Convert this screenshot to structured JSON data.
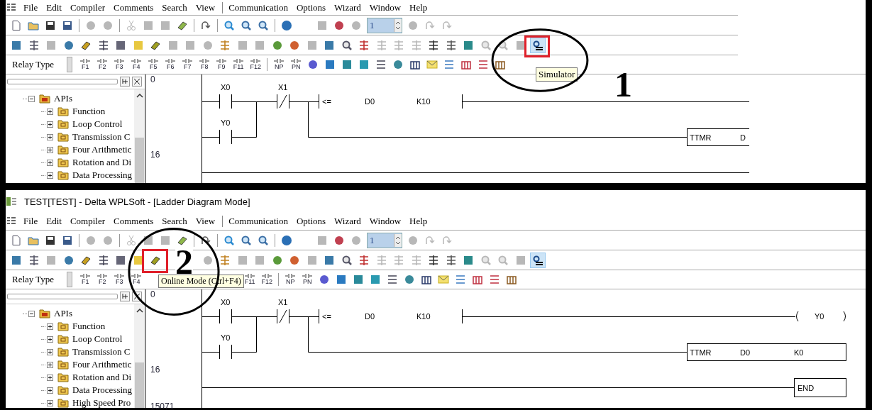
{
  "panels": [
    {
      "cropped_right": true,
      "menu": [
        "File",
        "Edit",
        "Compiler",
        "Comments",
        "Search",
        "View",
        "Communication",
        "Options",
        "Wizard",
        "Window",
        "Help"
      ],
      "spinner_value": "1",
      "relay_type": "Relay Type",
      "function_keys": [
        "F1",
        "F2",
        "F3",
        "F4",
        "F5",
        "F6",
        "F7",
        "F8",
        "F9",
        "F11",
        "F12",
        "NP",
        "PN"
      ],
      "simulator_marked": true,
      "online_mode_marked": false,
      "simulator_active": true,
      "tooltip": "Simulator",
      "annotation_number": "1",
      "tree": {
        "label": "APIs",
        "expanded": true,
        "children": [
          {
            "label": "Function",
            "expanded": false
          },
          {
            "label": "Loop Control",
            "expanded": false
          },
          {
            "label": "Transmission C",
            "expanded": false
          },
          {
            "label": "Four Arithmetic",
            "expanded": false
          },
          {
            "label": "Rotation and Di",
            "expanded": false
          },
          {
            "label": "Data Processing",
            "expanded": false
          }
        ]
      },
      "line_numbers": [
        "0",
        "16"
      ],
      "ladder": {
        "contacts": [
          {
            "label": "X0",
            "kind": "no"
          },
          {
            "label": "Y0",
            "kind": "no"
          },
          {
            "label": "X1",
            "kind": "nc"
          }
        ],
        "compare": {
          "op": "<=",
          "a": "D0",
          "b": "K10"
        },
        "timer": {
          "name": "TTMR",
          "a": "D"
        }
      }
    },
    {
      "cropped_right": false,
      "title": "TEST[TEST] - Delta WPLSoft - [Ladder Diagram Mode]",
      "menu": [
        "File",
        "Edit",
        "Compiler",
        "Comments",
        "Search",
        "View",
        "Communication",
        "Options",
        "Wizard",
        "Window",
        "Help"
      ],
      "spinner_value": "1",
      "relay_type": "Relay Type",
      "function_keys": [
        "F1",
        "F2",
        "F3",
        "F4",
        "F11",
        "F12",
        "NP",
        "PN"
      ],
      "simulator_marked": false,
      "online_mode_marked": true,
      "simulator_active": true,
      "tooltip": "Online Mode (Ctrl+F4)",
      "annotation_number": "2",
      "tree": {
        "label": "APIs",
        "expanded": true,
        "children": [
          {
            "label": "Function",
            "expanded": false
          },
          {
            "label": "Loop Control",
            "expanded": false
          },
          {
            "label": "Transmission C",
            "expanded": false
          },
          {
            "label": "Four Arithmetic",
            "expanded": false
          },
          {
            "label": "Rotation and Di",
            "expanded": false
          },
          {
            "label": "Data Processing",
            "expanded": false
          },
          {
            "label": "High Speed Pro",
            "expanded": false
          }
        ]
      },
      "line_numbers": [
        "0",
        "16",
        "15071"
      ],
      "ladder": {
        "contacts": [
          {
            "label": "X0",
            "kind": "no"
          },
          {
            "label": "Y0",
            "kind": "no"
          },
          {
            "label": "X1",
            "kind": "nc"
          }
        ],
        "compare": {
          "op": "<=",
          "a": "D0",
          "b": "K10"
        },
        "coil": "Y0",
        "timer": {
          "name": "TTMR",
          "a": "D0",
          "b": "K0"
        },
        "end": "END"
      }
    }
  ]
}
